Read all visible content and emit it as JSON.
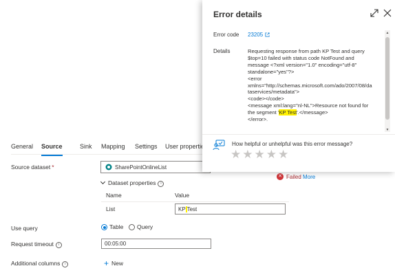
{
  "tabs": {
    "general": "General",
    "source": "Source",
    "sink": "Sink",
    "mapping": "Mapping",
    "settings": "Settings",
    "user_properties": "User properties"
  },
  "form": {
    "source_dataset_label": "Source dataset",
    "required_mark": "*",
    "source_dataset_value": "SharePointOnlineList",
    "status": {
      "failed": "Failed",
      "more": "More"
    },
    "dataset_properties": {
      "header": "Dataset properties",
      "col_name": "Name",
      "col_value": "Value",
      "rows": [
        {
          "name": "List",
          "value_pre": "KP",
          "value_mid": " ",
          "value_post": "Test"
        }
      ]
    },
    "use_query": {
      "label": "Use query",
      "options": [
        "Table",
        "Query"
      ],
      "selected": "Table"
    },
    "request_timeout": {
      "label": "Request timeout",
      "value": "00:05:00"
    },
    "additional_columns": {
      "label": "Additional columns",
      "new_label": "New"
    }
  },
  "error_panel": {
    "title": "Error details",
    "error_code_label": "Error code",
    "error_code": "23205",
    "details_label": "Details",
    "details_lines": [
      "Requesting response from path KP Test and query",
      "$top=10 failed with status code NotFound and",
      "message <?xml version=\"1.0\" encoding=\"utf-8\"",
      "standalone=\"yes\"?>",
      "<error",
      "xmlns=\"http://schemas.microsoft.com/ado/2007/08/da",
      "taservices/metadata\">",
      "<code></code>",
      "<message xml:lang=\"nl-NL\">Resource not found for"
    ],
    "details_seg_pre": "the segment '",
    "details_seg_hl": "KP Test",
    "details_seg_post": "'.</message>",
    "details_last": "</error>.",
    "feedback_question": "How helpful or unhelpful was this error message?",
    "star_glyph": "★",
    "rating": 0,
    "rating_max": 5
  },
  "colors": {
    "accent": "#0078d4",
    "error": "#d13438",
    "highlight": "#fff100"
  }
}
